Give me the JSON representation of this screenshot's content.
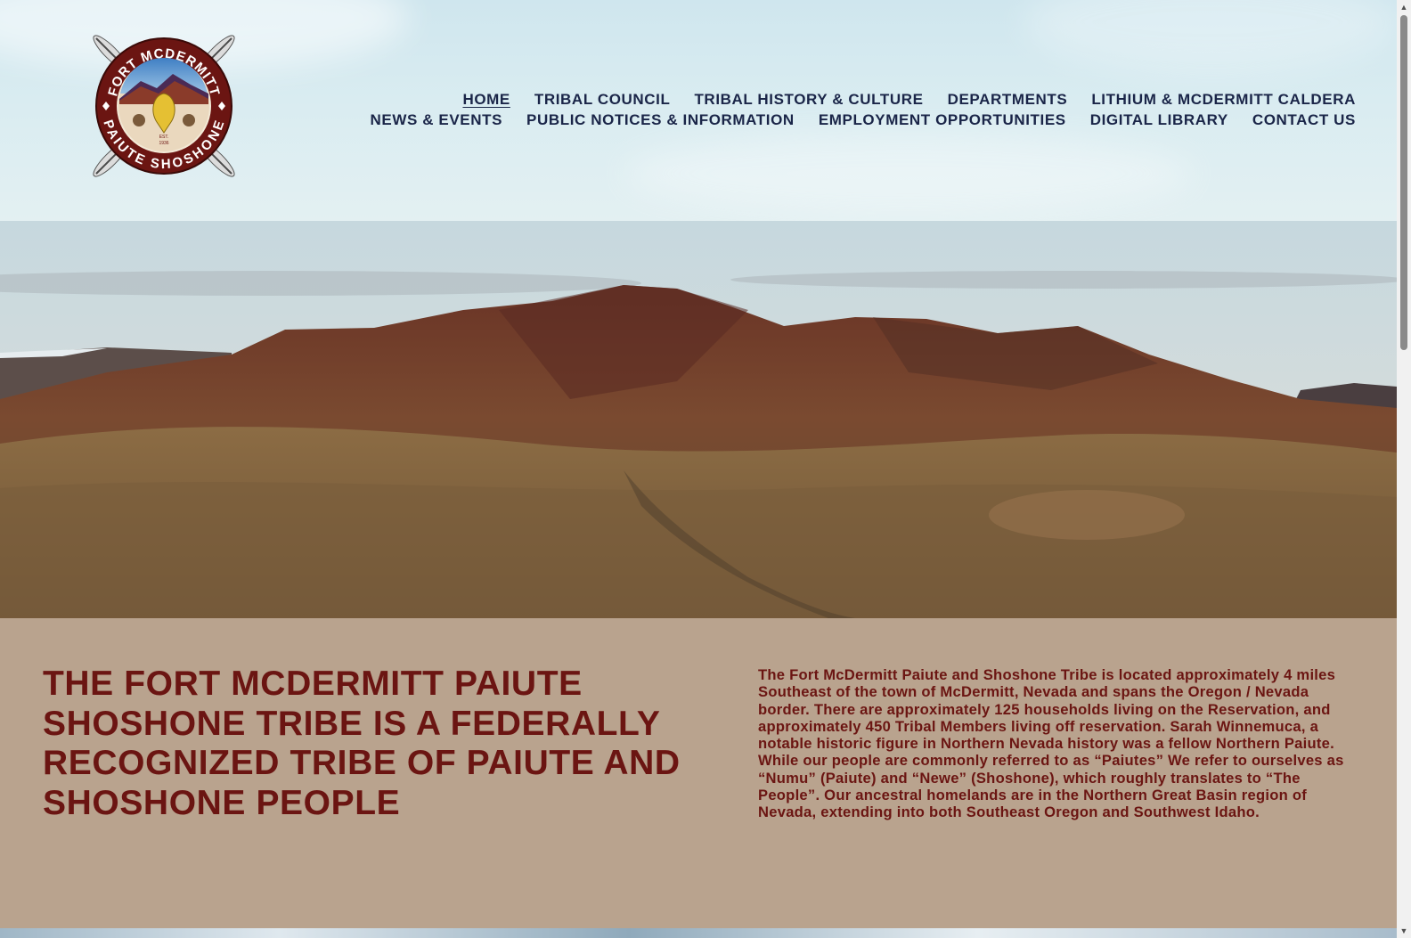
{
  "site": {
    "logo": {
      "top_text": "FORT MCDERMITT",
      "bottom_text": "PAIUTE SHOSHONE",
      "est_label": "EST.",
      "est_year": "1936"
    }
  },
  "nav": {
    "row1": [
      {
        "label": "HOME",
        "active": true
      },
      {
        "label": "TRIBAL COUNCIL"
      },
      {
        "label": "TRIBAL HISTORY & CULTURE"
      },
      {
        "label": "DEPARTMENTS"
      },
      {
        "label": "LITHIUM & MCDERMITT CALDERA"
      }
    ],
    "row2": [
      {
        "label": "NEWS & EVENTS"
      },
      {
        "label": "PUBLIC NOTICES & INFORMATION"
      },
      {
        "label": "EMPLOYMENT OPPORTUNITIES"
      },
      {
        "label": "DIGITAL LIBRARY"
      },
      {
        "label": "CONTACT US"
      }
    ]
  },
  "intro": {
    "heading": "THE FORT MCDERMITT PAIUTE SHOSHONE TRIBE IS A FEDERALLY RECOGNIZED TRIBE OF PAIUTE AND SHOSHONE PEOPLE",
    "body": "The Fort McDermitt Paiute and Shoshone Tribe is located approximately 4 miles Southeast of the town of McDermitt, Nevada and spans the Oregon / Nevada border. There are approximately 125 households living on the Reservation, and approximately 450 Tribal Members living off reservation. Sarah Winnemuca, a notable historic figure in Northern Nevada history was a fellow Northern Paiute. While our people are commonly referred to as “Paiutes” We refer to ourselves as “Numu” (Paiute) and “Newe” (Shoshone), which roughly translates to “The People”. Our ancestral homelands are in the Northern Great Basin region of Nevada, extending into both Southeast Oregon and Southwest Idaho."
  },
  "colors": {
    "nav_text": "#1a2548",
    "intro_bg": "#b9a38e",
    "intro_text": "#6b1512",
    "logo_ring": "#6b1512"
  }
}
